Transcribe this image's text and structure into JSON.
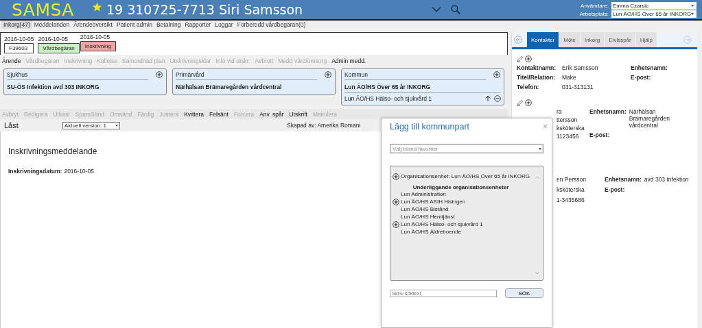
{
  "header": {
    "logo": "SAMSA",
    "patient": "19 310725-7713 Siri Samsson",
    "user_label": "Användare:",
    "user": "Emma Czarsic",
    "workplace_label": "Arbetsplats:",
    "workplace": "Lun ÄO/HS Över 65 år INKORG"
  },
  "menu": [
    {
      "label": "Inkorg(47)",
      "selected": true
    },
    {
      "label": "Meddelanden",
      "selected": false
    },
    {
      "label": "Ärendeöversikt",
      "selected": false
    },
    {
      "label": "Patient admin",
      "selected": false
    },
    {
      "label": "Betalning",
      "selected": false
    },
    {
      "label": "Rapporter",
      "selected": false
    },
    {
      "label": "Loggar",
      "selected": false
    },
    {
      "label": "Förberedd vårdbegäran(0)",
      "selected": false
    }
  ],
  "chips": [
    {
      "date": "2016-10-05",
      "label": "F39603",
      "color": "#ffffff"
    },
    {
      "date": "2016-10-05",
      "label": "Vårdbegäran",
      "color": "#c9f2c4"
    },
    {
      "date": "2016-10-05",
      "label": "Inskrivning",
      "color": "#f2a3a3"
    }
  ],
  "case_tabs": [
    {
      "label": "Ärende",
      "disabled": false
    },
    {
      "label": "Vårdbegäran",
      "disabled": true
    },
    {
      "label": "Inskrivning",
      "disabled": true
    },
    {
      "label": "Kallelse",
      "disabled": true
    },
    {
      "label": "Samordnad plan",
      "disabled": true
    },
    {
      "label": "Utskrivningsklar",
      "disabled": true
    },
    {
      "label": "Info vid utskr.",
      "disabled": true
    },
    {
      "label": "Avbrott",
      "disabled": true
    },
    {
      "label": "Medd vård/omsorg",
      "disabled": true
    },
    {
      "label": "Admin medd.",
      "disabled": false
    }
  ],
  "parties": [
    {
      "title": "Sjukhus",
      "units": [
        "SU-ÖS Infektion avd 303 INKORG"
      ]
    },
    {
      "title": "Primärvård",
      "units": [
        "Närhälsan Brämaregården vårdcentral"
      ]
    },
    {
      "title": "Kommun",
      "units": [
        "Lun ÄO/HS Över 65 år INKORG"
      ],
      "sub_units": [
        "Lun ÄO/HS Hälso- och sjukvård 1"
      ]
    }
  ],
  "actions": [
    {
      "label": "Avbryt",
      "disabled": true
    },
    {
      "label": "Redigera",
      "disabled": true
    },
    {
      "label": "Utkast",
      "disabled": true
    },
    {
      "label": "SparaSänd",
      "disabled": true
    },
    {
      "label": "Omsänd",
      "disabled": true
    },
    {
      "label": "Färdig",
      "disabled": true
    },
    {
      "label": "Justera",
      "disabled": true
    },
    {
      "label": "Kvittera",
      "disabled": false
    },
    {
      "label": "Felsänt",
      "disabled": false
    },
    {
      "label": "Forcera",
      "disabled": true
    },
    {
      "label": "Anv. spår",
      "disabled": false
    },
    {
      "label": "Utskrift",
      "disabled": false
    },
    {
      "label": "Makulera",
      "disabled": true
    }
  ],
  "document": {
    "status": "Låst",
    "version": "Aktuell version: 1",
    "created_by": "Skapad av: Amerika Romani",
    "title": "Inskrivningsmeddelande",
    "date_label": "Inskrivningsdatum:",
    "date": "2016-10-05"
  },
  "side_panel": {
    "tabs": [
      {
        "label": "Kontakter",
        "selected": true
      },
      {
        "label": "Möte",
        "selected": false
      },
      {
        "label": "Inkorg",
        "selected": false
      },
      {
        "label": "Elvisspår",
        "selected": false
      },
      {
        "label": "Hjälp",
        "selected": false
      }
    ],
    "contacts": [
      {
        "tools": true,
        "left": [
          {
            "label": "Kontaktnamn:",
            "value": "Erik Samsson"
          },
          {
            "label": "Titel/Relation:",
            "value": "Make"
          },
          {
            "label": "Telefon:",
            "value": "031-313131"
          }
        ],
        "right": [
          {
            "label": "Enhetsnamn:"
          },
          {
            "label": "E-post:"
          }
        ]
      },
      {
        "tools": true,
        "left": [
          {
            "value": "ra"
          },
          {
            "value": "ttersson"
          },
          {
            "value": "ksköterska"
          },
          {
            "value": "1123456"
          }
        ],
        "right": [
          {
            "label": "Enhetsnamn:",
            "value": "Närhälsan Brämaregården vårdcentral"
          },
          {
            "label": "E-post:"
          }
        ]
      },
      {
        "left": [
          {
            "value": "en Persson"
          },
          {
            "value": "ksköterska"
          },
          {
            "value": "1-3435686"
          }
        ],
        "right": [
          {
            "label": "Enhetsnamn:",
            "value": "avd 303 Infektion"
          },
          {
            "label": "E-post:"
          }
        ]
      }
    ]
  },
  "dialog": {
    "title": "Lägg till kommunpart",
    "close": "×",
    "favorites": {
      "placeholder": "Välj bland favoriter"
    },
    "org_unit": {
      "label": "Organisationsenhet: Lun ÄO/HS Över 65 år INKORG"
    },
    "sub_heading": "Underliggande organisationsenheter",
    "sub_units": [
      {
        "label": "Lun Administration",
        "expandable": false
      },
      {
        "label": "Lun ÄO/HS ASIH Hisingen",
        "expandable": true
      },
      {
        "label": "Lun ÄO/HS Bistånd",
        "expandable": false
      },
      {
        "label": "Lun ÄO/HS Hemtjänst",
        "expandable": false
      },
      {
        "label": "Lun ÄO/HS Hälso- och sjukvård 1",
        "expandable": true
      },
      {
        "label": "Lun ÄO/HS Äldreboende",
        "expandable": false
      }
    ],
    "search": {
      "placeholder": "Skriv söktext"
    },
    "search_button": "SÖK"
  }
}
